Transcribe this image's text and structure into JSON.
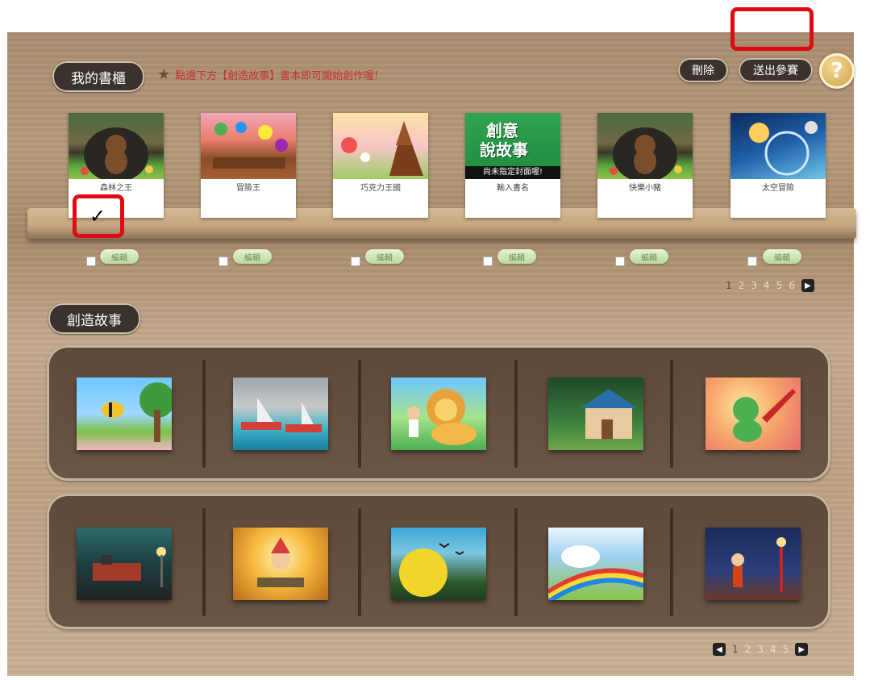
{
  "header": {
    "shelf_title": "我的書櫃",
    "hint": "點選下方【創造故事】書本即可開始創作喔!",
    "delete_label": "刪除",
    "submit_label": "送出參賽",
    "help_glyph": "?"
  },
  "books": [
    {
      "title": "森林之王",
      "checked": true
    },
    {
      "title": "冒險王",
      "checked": false
    },
    {
      "title": "巧克力王國",
      "checked": false
    },
    {
      "title": "輸入書名",
      "checked": false,
      "cover_text": [
        "創意",
        "說故事",
        "尚未指定封面喔!"
      ]
    },
    {
      "title": "快樂小豬",
      "checked": false
    },
    {
      "title": "太空冒險",
      "checked": false
    }
  ],
  "edit_label": "編輯",
  "checkmark": "✓",
  "shelf_pager": {
    "pages": [
      "1",
      "2",
      "3",
      "4",
      "5",
      "6"
    ],
    "current": "1"
  },
  "create": {
    "title": "創造故事",
    "pager": {
      "pages": [
        "1",
        "2",
        "3",
        "4",
        "5"
      ],
      "current": "1"
    }
  },
  "colors": {
    "hint_red": "#c8322d",
    "highlight_red": "#e00b12",
    "pill_bg": "#3a322c"
  }
}
